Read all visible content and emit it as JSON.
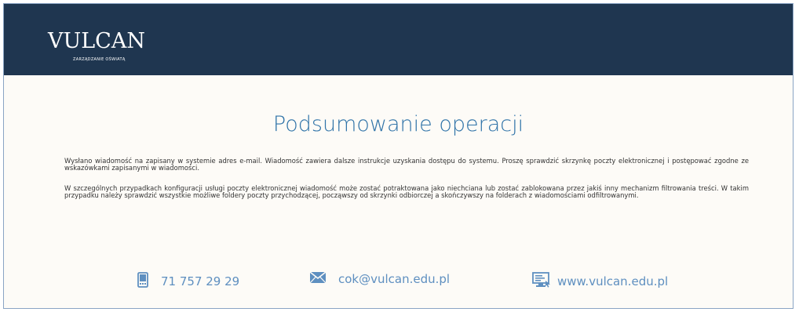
{
  "header": {
    "logo_text": "VULCAN",
    "logo_tagline": "ZARZĄDZANIE OŚWIATĄ"
  },
  "main": {
    "title": "Podsumowanie operacji",
    "paragraph_1": "Wysłano wiadomość na zapisany w systemie adres e-mail. Wiadomość zawiera dalsze instrukcje uzyskania dostępu do systemu. Proszę sprawdzić skrzynkę poczty elektronicznej i postępować zgodne ze wskazówkami zapisanymi w wiadomości.",
    "paragraph_2": "W szczególnych przypadkach konfiguracji usługi poczty elektronicznej wiadomość może zostać potraktowana jako niechciana lub zostać zablokowana przez jakiś inny mechanizm filtrowania treści. W takim przypadku należy sprawdzić wszystkie możliwe foldery poczty przychodzącej, począwszy od skrzynki odbiorczej a skończywszy na folderach z wiadomościami odfiltrowanymi."
  },
  "footer": {
    "phone": "71 757 29 29",
    "email": "cok@vulcan.edu.pl",
    "website": "www.vulcan.edu.pl",
    "phone_icon": "phone-icon",
    "email_icon": "envelope-icon",
    "website_icon": "monitor-icon"
  },
  "colors": {
    "header_bg": "#1f3650",
    "title": "#2f73a8",
    "footer_text": "#5e8fc0",
    "page_bg": "#fdfbf7"
  }
}
